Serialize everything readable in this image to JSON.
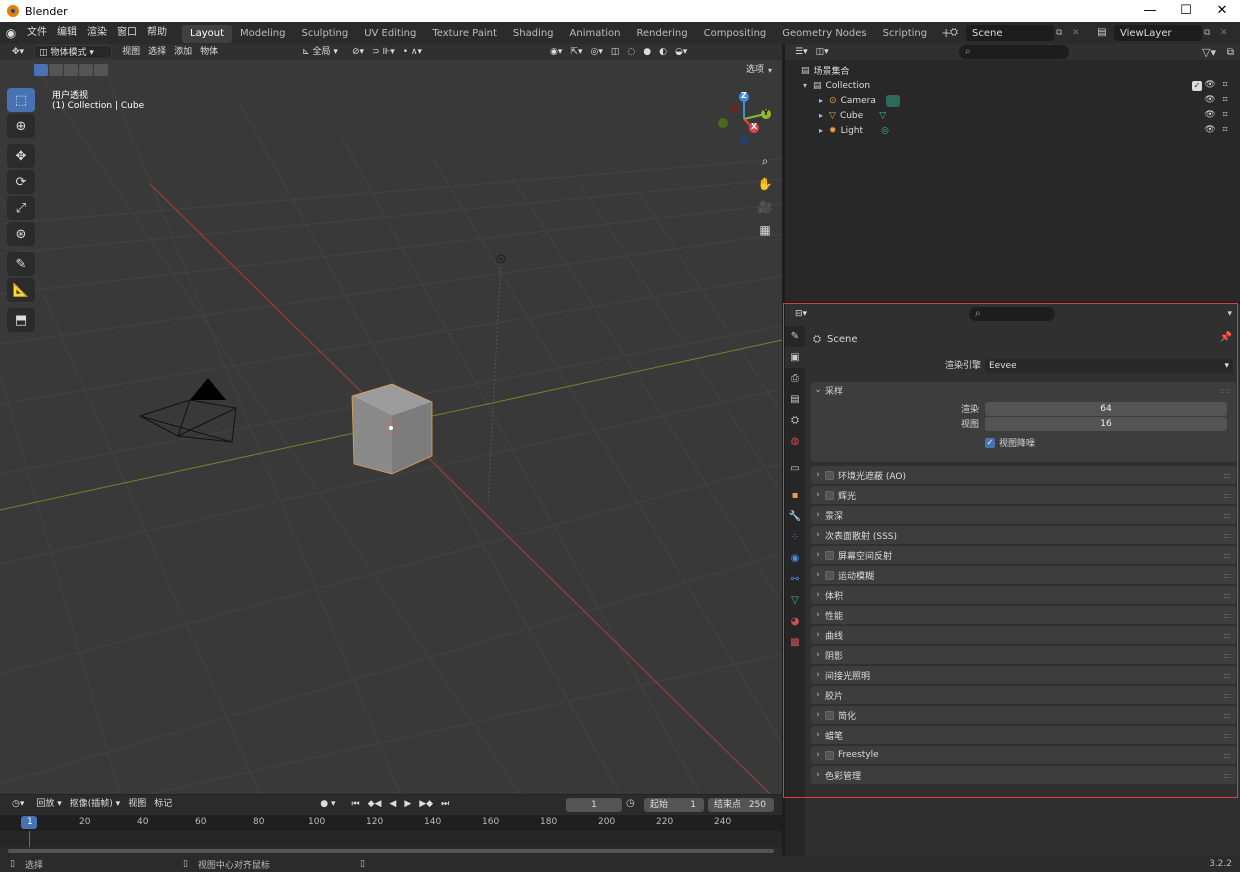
{
  "window": {
    "title": "Blender",
    "buttons": [
      "—",
      "☐",
      "✕"
    ]
  },
  "menu": [
    "文件",
    "编辑",
    "渲染",
    "窗口",
    "帮助"
  ],
  "workspaces": [
    "Layout",
    "Modeling",
    "Sculpting",
    "UV Editing",
    "Texture Paint",
    "Shading",
    "Animation",
    "Rendering",
    "Compositing",
    "Geometry Nodes",
    "Scripting"
  ],
  "active_workspace": "Layout",
  "scene": {
    "name": "Scene",
    "view_layer": "ViewLayer"
  },
  "viewport": {
    "mode": "物体模式",
    "menus": [
      "视图",
      "选择",
      "添加",
      "物体"
    ],
    "transform_orientation": "全局",
    "options_label": "选项",
    "overlay_title": "用户透视",
    "overlay_sub": "(1) Collection | Cube",
    "gizmo_axes": {
      "z": "Z",
      "y": "Y",
      "x": "X"
    }
  },
  "timeline": {
    "menus": [
      "回放",
      "抠像(插帧)",
      "视图",
      "标记"
    ],
    "current_frame": "1",
    "start_label": "起始",
    "start": "1",
    "end_label": "结束点",
    "end": "250",
    "ruler": [
      "1",
      "20",
      "40",
      "60",
      "80",
      "100",
      "120",
      "140",
      "160",
      "180",
      "200",
      "220",
      "240"
    ]
  },
  "status": {
    "select": "选择",
    "center": "视图中心对齐鼠标",
    "version": "3.2.2"
  },
  "outliner": {
    "root": "场景集合",
    "collection": "Collection",
    "objects": [
      "Camera",
      "Cube",
      "Light"
    ]
  },
  "properties": {
    "context": "Scene",
    "render_engine_label": "渲染引擎",
    "render_engine": "Eevee",
    "sampling": {
      "title": "采样",
      "render_label": "渲染",
      "render": "64",
      "viewport_label": "视图",
      "viewport": "16",
      "denoise_label": "视图降噪"
    },
    "panels": [
      {
        "label": "环境光遮蔽 (AO)",
        "checkbox": true
      },
      {
        "label": "辉光",
        "checkbox": true
      },
      {
        "label": "景深",
        "checkbox": false
      },
      {
        "label": "次表面散射 (SSS)",
        "checkbox": false
      },
      {
        "label": "屏幕空间反射",
        "checkbox": true
      },
      {
        "label": "运动模糊",
        "checkbox": true
      },
      {
        "label": "体积",
        "checkbox": false
      },
      {
        "label": "性能",
        "checkbox": false
      },
      {
        "label": "曲线",
        "checkbox": false
      },
      {
        "label": "阴影",
        "checkbox": false
      },
      {
        "label": "间接光照明",
        "checkbox": false
      },
      {
        "label": "胶片",
        "checkbox": false
      },
      {
        "label": "简化",
        "checkbox": true
      },
      {
        "label": "蜡笔",
        "checkbox": false
      },
      {
        "label": "Freestyle",
        "checkbox": true
      },
      {
        "label": "色彩管理",
        "checkbox": false
      }
    ]
  },
  "colors": {
    "accent": "#4772b3",
    "highlight": "#e23b3b",
    "x_axis": "#e04848",
    "y_axis": "#8dbb30",
    "z_axis": "#3d8de0"
  }
}
